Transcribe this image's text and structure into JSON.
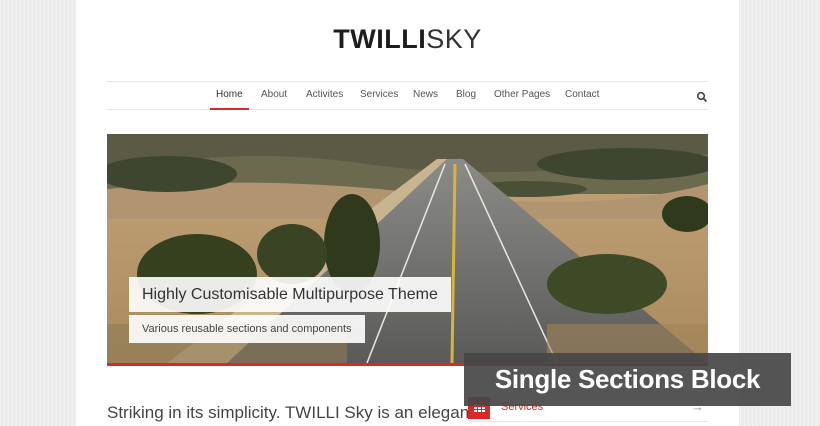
{
  "header": {
    "logo_bold": "TWILLI",
    "logo_light": "SKY"
  },
  "nav": {
    "items": [
      {
        "label": "Home",
        "active": true
      },
      {
        "label": "About"
      },
      {
        "label": "Activites"
      },
      {
        "label": "Services"
      },
      {
        "label": "News"
      },
      {
        "label": "Blog"
      },
      {
        "label": "Other Pages"
      },
      {
        "label": "Contact"
      }
    ],
    "search_icon": "search-icon"
  },
  "hero": {
    "title": "Highly Customisable Multipurpose Theme",
    "subtitle": "Various reusable sections and components",
    "image_subject": "road-through-hills-photo"
  },
  "content": {
    "intro": "Striking in its simplicity. TWILLI Sky is an elegant",
    "services_label": "Services",
    "services_icon": "grid-icon",
    "arrow_icon": "arrow-right-icon"
  },
  "badge": {
    "text": "Single Sections Block"
  },
  "colors": {
    "accent": "#d62a2a",
    "page_bg": "#ececec",
    "badge_bg": "#464646"
  }
}
